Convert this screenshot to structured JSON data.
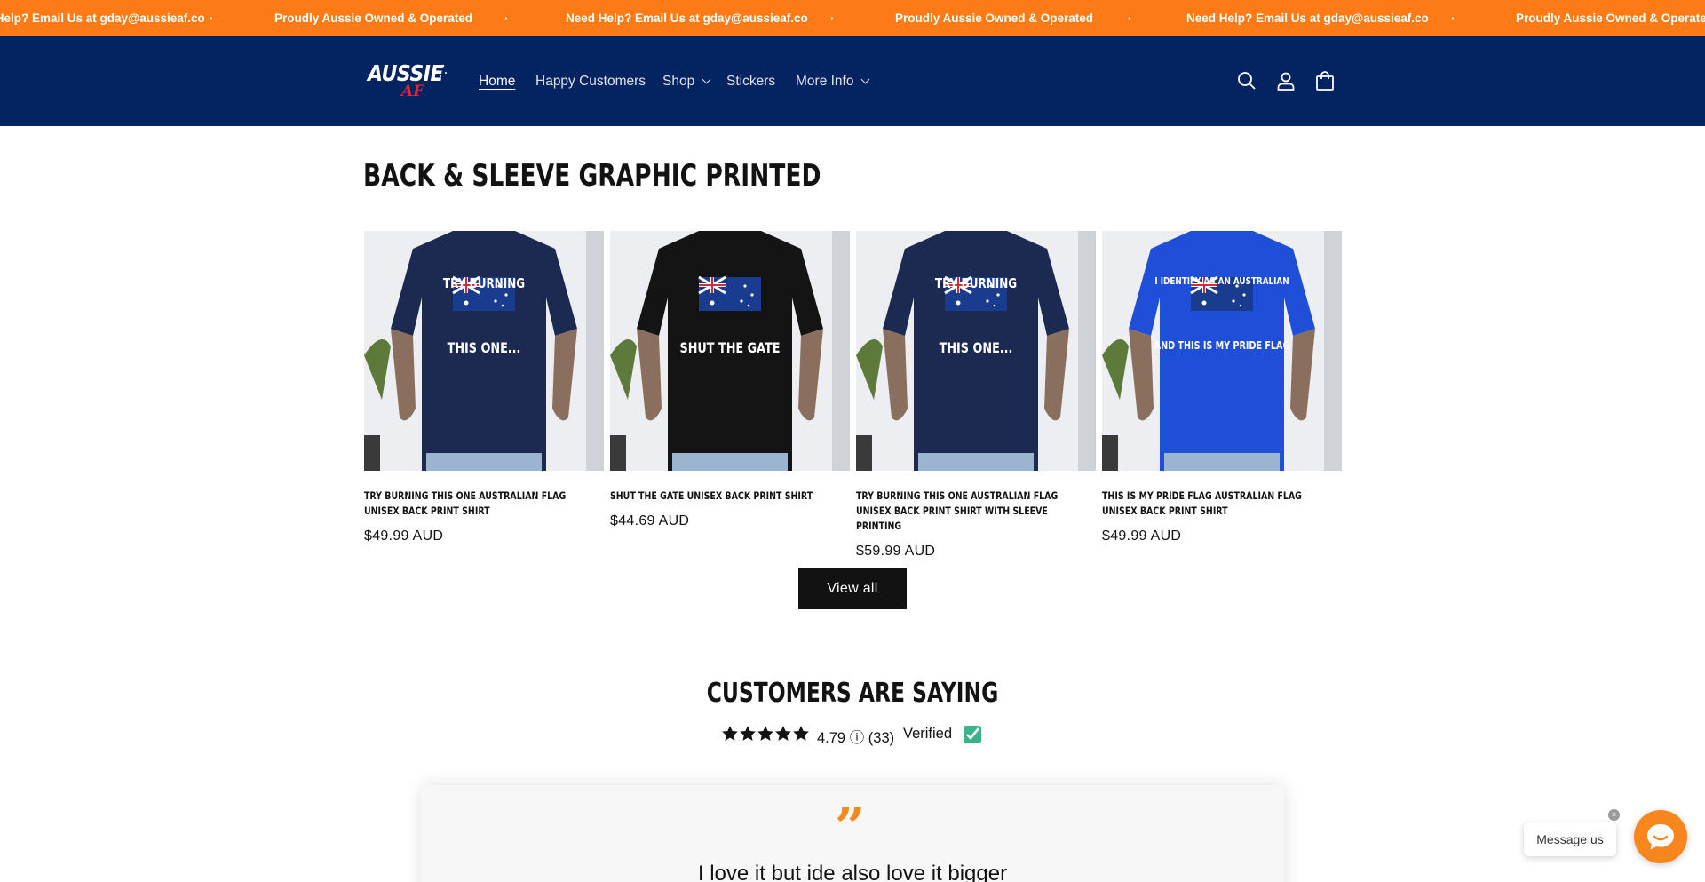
{
  "announcement": {
    "items": [
      "Need Help? Email Us at gday@aussieaf.co",
      "Proudly Aussie Owned & Operated",
      "Need Help? Email Us at gday@aussieaf.co",
      "Proudly Aussie Owned & Operated",
      "Need Help? Email Us at gday@aussieaf.co",
      "Proudly Aussie Owned & Operated"
    ],
    "separator": "·",
    "bg_color": "#fc7b16"
  },
  "header": {
    "bg_color": "#042461",
    "logo": {
      "main": "AUSSIE",
      "sub": "AF"
    },
    "nav": [
      {
        "label": "Home",
        "active": true
      },
      {
        "label": "Happy Customers"
      },
      {
        "label": "Shop",
        "dropdown": true
      },
      {
        "label": "Stickers"
      },
      {
        "label": "More Info",
        "dropdown": true
      }
    ],
    "icons": [
      "search-icon",
      "account-icon",
      "cart-icon"
    ]
  },
  "products_section": {
    "title": "BACK & SLEEVE GRAPHIC PRINTED",
    "products": [
      {
        "title": "TRY BURNING THIS ONE AUSTRALIAN FLAG UNISEX BACK PRINT SHIRT",
        "price": "$49.99 AUD",
        "shirt_color": "#1c2a52",
        "print_top": "TRY BURNING",
        "print_bottom": "THIS ONE..."
      },
      {
        "title": "SHUT THE GATE UNISEX BACK PRINT SHIRT",
        "price": "$44.69 AUD",
        "shirt_color": "#141414",
        "print_top": "",
        "print_bottom": "SHUT THE GATE"
      },
      {
        "title": "TRY BURNING THIS ONE AUSTRALIAN FLAG UNISEX BACK PRINT SHIRT WITH SLEEVE PRINTING",
        "price": "$59.99 AUD",
        "shirt_color": "#1c2a52",
        "print_top": "TRY BURNING",
        "print_bottom": "THIS ONE..."
      },
      {
        "title": "THIS IS MY PRIDE FLAG AUSTRALIAN FLAG UNISEX BACK PRINT SHIRT",
        "price": "$49.99 AUD",
        "shirt_color": "#1f4fd8",
        "print_top": "I IDENTIFY AS AN AUSTRALIAN",
        "print_bottom": "AND THIS IS MY PRIDE FLAG"
      }
    ],
    "view_all": "View all"
  },
  "reviews": {
    "title": "CUSTOMERS ARE SAYING",
    "rating_text": "4.79 ⓘ (33)",
    "verified": "Verified",
    "quote_mark": "”",
    "review_text": "I love it but ide also love it bigger",
    "star_color": "#121212",
    "quote_color": "#f28a1d"
  },
  "chat": {
    "label": "Message us",
    "close": "×",
    "button_color": "#f7861f"
  }
}
